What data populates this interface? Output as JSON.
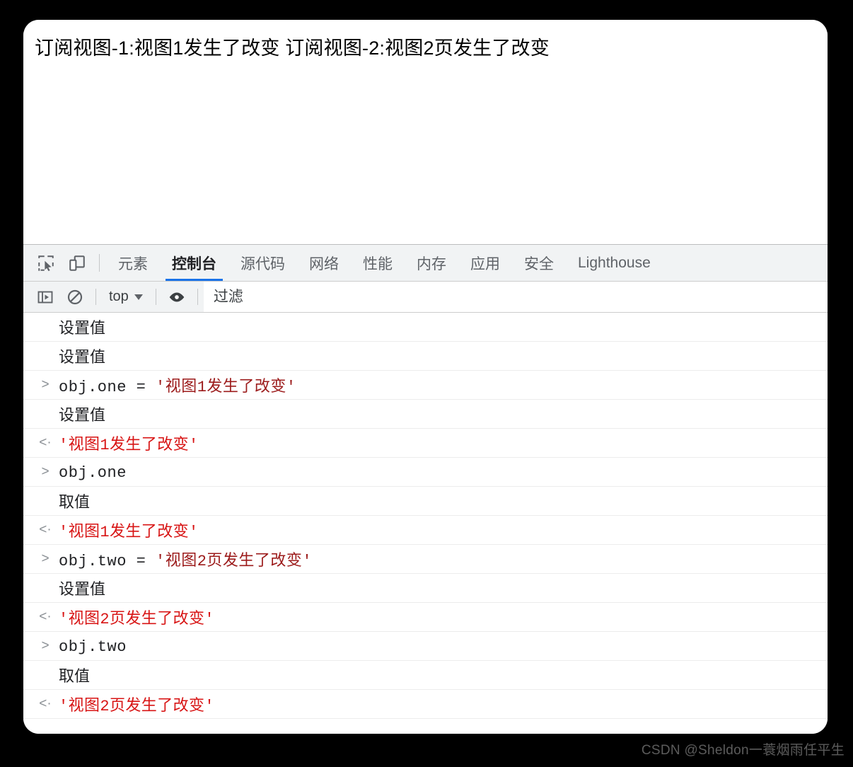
{
  "page": {
    "content_text": "订阅视图-1:视图1发生了改变 订阅视图-2:视图2页发生了改变"
  },
  "devtools": {
    "tabs": [
      {
        "label": "元素",
        "active": false
      },
      {
        "label": "控制台",
        "active": true
      },
      {
        "label": "源代码",
        "active": false
      },
      {
        "label": "网络",
        "active": false
      },
      {
        "label": "性能",
        "active": false
      },
      {
        "label": "内存",
        "active": false
      },
      {
        "label": "应用",
        "active": false
      },
      {
        "label": "安全",
        "active": false
      },
      {
        "label": "Lighthouse",
        "active": false
      }
    ],
    "icons": {
      "inspect": "inspect-element-icon",
      "device": "device-toolbar-icon",
      "sidebar": "console-sidebar-icon",
      "clear": "clear-console-icon",
      "eye": "console-settings-eye-icon"
    },
    "filterbar": {
      "context_label": "top",
      "filter_value": "",
      "filter_placeholder": "过滤"
    },
    "accent_color": "#1a73e8",
    "console_rows": [
      {
        "kind": "log",
        "marker": "",
        "text": "设置值"
      },
      {
        "kind": "log",
        "marker": "",
        "text": "设置值"
      },
      {
        "kind": "input",
        "marker": ">",
        "expr": "obj.one = ",
        "string": "'视图1发生了改变'"
      },
      {
        "kind": "log",
        "marker": "",
        "text": "设置值"
      },
      {
        "kind": "output",
        "marker": "<·",
        "text": "'视图1发生了改变'"
      },
      {
        "kind": "input",
        "marker": ">",
        "expr": "obj.one",
        "string": ""
      },
      {
        "kind": "log",
        "marker": "",
        "text": "取值"
      },
      {
        "kind": "output",
        "marker": "<·",
        "text": "'视图1发生了改变'"
      },
      {
        "kind": "input",
        "marker": ">",
        "expr": "obj.two = ",
        "string": "'视图2页发生了改变'"
      },
      {
        "kind": "log",
        "marker": "",
        "text": "设置值"
      },
      {
        "kind": "output",
        "marker": "<·",
        "text": "'视图2页发生了改变'"
      },
      {
        "kind": "input",
        "marker": ">",
        "expr": "obj.two",
        "string": ""
      },
      {
        "kind": "log",
        "marker": "",
        "text": "取值"
      },
      {
        "kind": "output",
        "marker": "<·",
        "text": "'视图2页发生了改变'"
      }
    ]
  },
  "watermark": {
    "text": "CSDN @Sheldon一蓑烟雨任平生"
  }
}
